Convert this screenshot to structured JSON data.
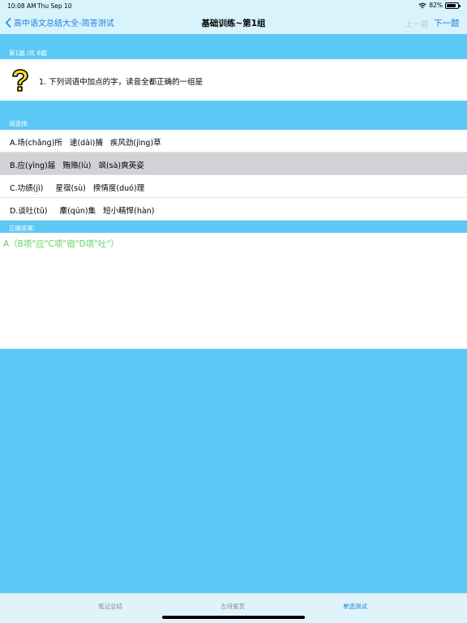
{
  "status": {
    "time": "10:08 AM",
    "date": "Thu Sep 10",
    "battery": "82%",
    "battery_level": 0.82
  },
  "nav": {
    "back_label": "高中语文总结大全-简答测试",
    "title": "基础训练~第1组",
    "prev_label": "上一题",
    "next_label": "下一题"
  },
  "question": {
    "counter": "第1题 /共 6题",
    "text": "1.  下列词语中加点的字，读音全都正确的一组是"
  },
  "choose_label": "请选择:",
  "options": [
    {
      "label": "A.场(chǎng)所   逮(dài)捕   疾风劲(jìng)草",
      "selected": false
    },
    {
      "label": "B.应(yìng)届   贿赂(lù)   飒(sà)爽英姿",
      "selected": true
    },
    {
      "label": "C.功绩(jì)     星宿(sù)   揆情度(duó)理",
      "selected": false
    },
    {
      "label": "D.谈吐(tǔ)     麇(qún)集   短小精悍(hàn)",
      "selected": false
    }
  ],
  "answer": {
    "label": "正确答案:",
    "text": "A（B项\"应\"C项\"宿\"D项\"吐\"）",
    "color": "#5fd35f"
  },
  "tabs": [
    {
      "label": "笔记总结",
      "active": false
    },
    {
      "label": "古诗鉴赏",
      "active": false
    },
    {
      "label": "单选测试",
      "active": true
    }
  ],
  "colors": {
    "accent": "#1c7ee0",
    "background": "#5bc8f5",
    "header": "#d8f3fb",
    "selected_row": "#d1d1d6"
  }
}
